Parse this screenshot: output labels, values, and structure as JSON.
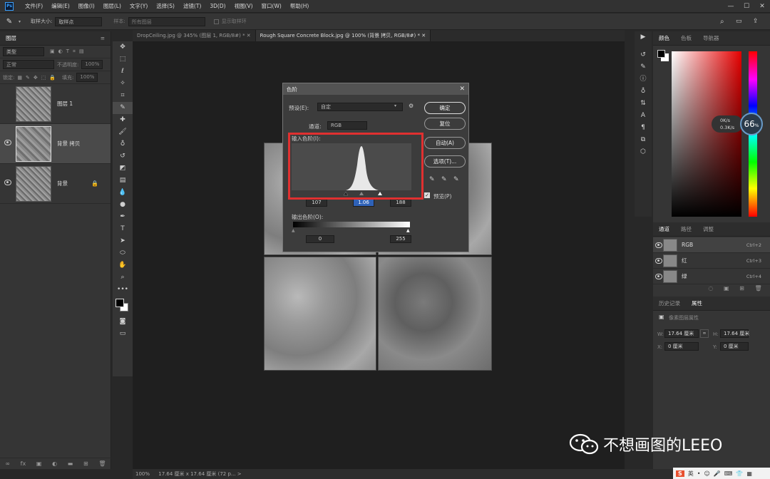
{
  "menubar": {
    "items": [
      "文件(F)",
      "编辑(E)",
      "图像(I)",
      "图层(L)",
      "文字(Y)",
      "选择(S)",
      "滤镜(T)",
      "3D(D)",
      "视图(V)",
      "窗口(W)",
      "帮助(H)"
    ],
    "minimize": "—",
    "maximize": "☐",
    "close": "✕"
  },
  "optbar": {
    "sample_size_label": "取样大小:",
    "sample_size_value": "取样点",
    "sample_label": "样本:",
    "sample_value": "所有图层",
    "show_ring_label": "显示取样环"
  },
  "layers_panel": {
    "tab": "图层",
    "filter_kind": "类型",
    "blend_mode": "正常",
    "opacity_label": "不透明度:",
    "opacity_value": "100%",
    "lock_label": "锁定:",
    "fill_label": "填充:",
    "fill_value": "100%",
    "layers": [
      {
        "name": "图层 1",
        "visible": false
      },
      {
        "name": "背景 拷贝",
        "visible": true
      },
      {
        "name": "背景",
        "visible": true,
        "locked": true
      }
    ]
  },
  "doc_tabs": [
    {
      "label": "DropCeiling.jpg @ 345% (图层 1, RGB/8#) *  ✕"
    },
    {
      "label": "Rough Square Concrete Block.jpg @ 100% (背景 拷贝, RGB/8#) *  ✕"
    }
  ],
  "levels_dialog": {
    "title": "色阶",
    "preset_label": "预设(E):",
    "preset_value": "自定",
    "channel_label": "通道:",
    "channel_value": "RGB",
    "input_levels_label": "输入色阶(I):",
    "input_black": "107",
    "input_gamma": "1.06",
    "input_white": "188",
    "output_levels_label": "输出色阶(O):",
    "output_black": "0",
    "output_white": "255",
    "ok": "确定",
    "reset": "复位",
    "auto": "自动(A)",
    "options": "选项(T)...",
    "preview_label": "预览(P)",
    "preview_checked": true
  },
  "color_panel": {
    "tabs": [
      "颜色",
      "色板",
      "导航器"
    ],
    "speed_up": "0K/s",
    "speed_down": "0.3K/s",
    "percent": "66"
  },
  "channels_panel": {
    "tabs": [
      "通道",
      "路径",
      "调整"
    ],
    "channels": [
      {
        "name": "RGB",
        "shortcut": "Ctrl+2"
      },
      {
        "name": "红",
        "shortcut": "Ctrl+3"
      },
      {
        "name": "绿",
        "shortcut": "Ctrl+4"
      }
    ]
  },
  "properties_panel": {
    "tabs": [
      "历史记录",
      "属性"
    ],
    "section": "像素图层属性",
    "w_label": "W:",
    "w_value": "17.64 厘米",
    "h_label": "H:",
    "h_value": "17.64 厘米",
    "x_label": "X:",
    "x_value": "0 厘米",
    "y_label": "Y:",
    "y_value": "0 厘米"
  },
  "status": {
    "zoom": "100%",
    "doc_size": "17.64 厘米 x 17.64 厘米 (72 p... >"
  },
  "watermark": "不想画图的LEEO",
  "taskbar_ime": "英",
  "accent": "#e03030"
}
